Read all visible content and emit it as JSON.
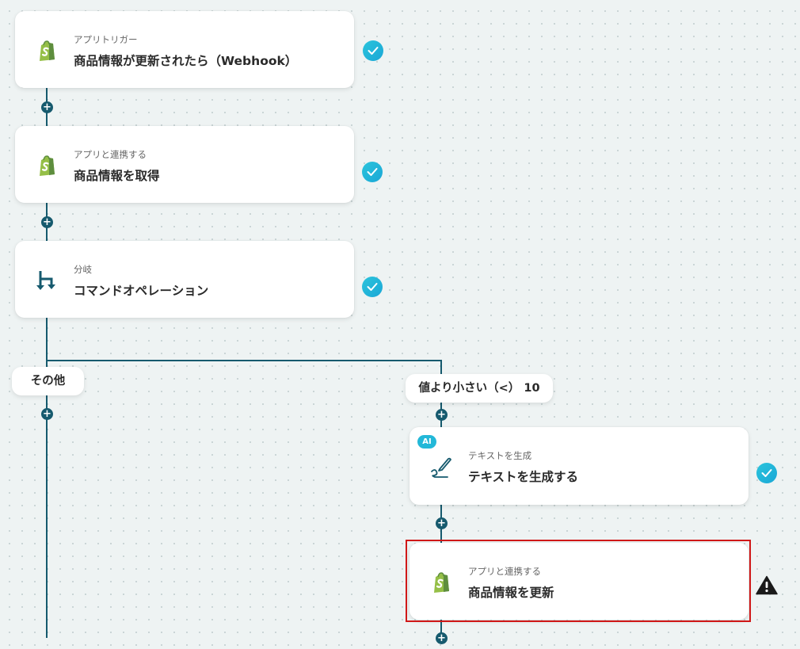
{
  "nodes": [
    {
      "category": "アプリトリガー",
      "title": "商品情報が更新されたら（Webhook）",
      "icon": "shopify-icon",
      "status": "completed"
    },
    {
      "category": "アプリと連携する",
      "title": "商品情報を取得",
      "icon": "shopify-icon",
      "status": "completed"
    },
    {
      "category": "分岐",
      "title": "コマンドオペレーション",
      "icon": "branch-icon",
      "status": "completed"
    },
    {
      "category": "テキストを生成",
      "title": "テキストを生成する",
      "icon": "pen-icon",
      "badge": "AI",
      "status": "completed"
    },
    {
      "category": "アプリと連携する",
      "title": "商品情報を更新",
      "icon": "shopify-icon",
      "status": "warning"
    }
  ],
  "branches": {
    "left_label": "その他",
    "right_label": "値より小さい（<） 10"
  },
  "colors": {
    "connector": "#165a6e",
    "check": "#23b8d8",
    "shopify": "#95bf47",
    "highlight": "#d01818"
  },
  "add_step_symbol": "+"
}
